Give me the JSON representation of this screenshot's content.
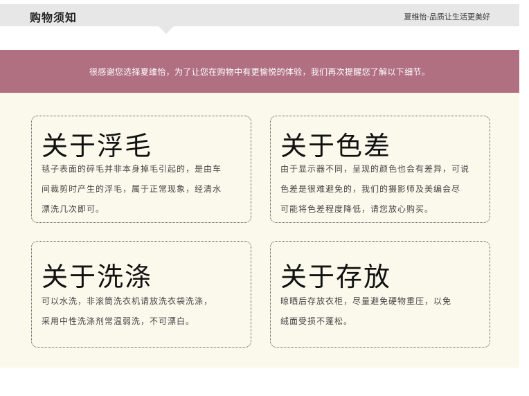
{
  "header": {
    "title": "购物须知",
    "slogan": "夏维怡·品质让生活更美好"
  },
  "banner": {
    "text": "很感谢您选择夏维怡，为了让您在购物中有更愉悦的体验，我们再次提醒您了解以下细节。"
  },
  "cards": [
    {
      "title": "关于浮毛",
      "lines": [
        "毯子表面的碎毛并非本身掉毛引起的，是由车",
        "间裁剪时产生的浮毛，属于正常现象，经清水",
        "漂洗几次即可。"
      ]
    },
    {
      "title": "关于色差",
      "lines": [
        "由于显示器不同，呈现的颜色也会有差异，可说",
        "色差是很难避免的，我们的摄影师及美编会尽",
        "可能将色差程度降低，请您放心购买。"
      ]
    },
    {
      "title": "关于洗涤",
      "lines": [
        "可以水洗，非滚筒洗衣机请放洗衣袋洗涤，",
        "采用中性洗涤剂常温弱洗，不可漂白。"
      ]
    },
    {
      "title": "关于存放",
      "lines": [
        "晾晒后存放衣柜，尽量避免硬物重压，以免",
        "绒面受损不蓬松。"
      ]
    }
  ],
  "colors": {
    "header_bg": "#e7e7e7",
    "banner_bg": "#b07082",
    "content_bg": "#fbf9ec"
  }
}
